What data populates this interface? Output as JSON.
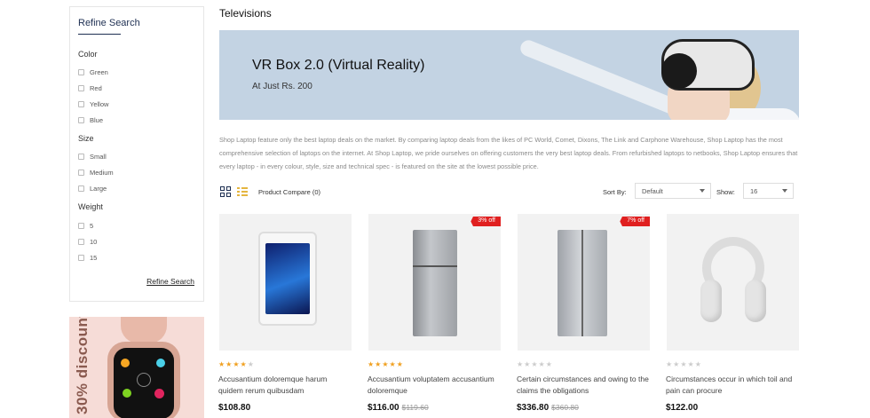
{
  "sidebar": {
    "title": "Refine Search",
    "groups": [
      {
        "title": "Color",
        "options": [
          "Green",
          "Red",
          "Yellow",
          "Blue"
        ]
      },
      {
        "title": "Size",
        "options": [
          "Small",
          "Medium",
          "Large"
        ]
      },
      {
        "title": "Weight",
        "options": [
          "5",
          "10",
          "15"
        ]
      }
    ],
    "refine_link": "Refine Search",
    "promo_text": "30% discount"
  },
  "page_title": "Televisions",
  "banner": {
    "heading": "VR Box 2.0 (Virtual Reality)",
    "subheading": "At Just Rs. 200"
  },
  "description": "Shop Laptop feature only the best laptop deals on the market. By comparing laptop deals from the likes of PC World, Comet, Dixons, The Link and Carphone Warehouse, Shop Laptop has the most comprehensive selection of laptops on the internet. At Shop Laptop, we pride ourselves on offering customers the very best laptop deals. From refurbished laptops to netbooks, Shop Laptop ensures that every laptop - in every colour, style, size and technical spec - is featured on the site at the lowest possible price.",
  "toolbar": {
    "compare": "Product Compare (0)",
    "sort_label": "Sort By:",
    "sort_value": "Default",
    "show_label": "Show:",
    "show_value": "16"
  },
  "colors": {
    "accent": "#1e2f52",
    "star_on": "#f0a020",
    "star_off": "#cccccc",
    "badge": "#e02020"
  },
  "products": [
    {
      "title": "Accusantium doloremque harum quidem rerum quibusdam",
      "price": "$108.80",
      "old_price": "",
      "badge": "",
      "rating": 4,
      "image": "tablet-image"
    },
    {
      "title": "Accusantium voluptatem accusantium doloremque",
      "price": "$116.00",
      "old_price": "$119.60",
      "badge": "3% off",
      "rating": 5,
      "image": "refrigerator-image"
    },
    {
      "title": "Certain circumstances and owing to the claims the obligations",
      "price": "$336.80",
      "old_price": "$360.80",
      "badge": "7% off",
      "rating": 0,
      "image": "side-by-side-fridge-image"
    },
    {
      "title": "Circumstances occur in which toil and pain can procure",
      "price": "$122.00",
      "old_price": "",
      "badge": "",
      "rating": 0,
      "image": "headphones-image"
    }
  ]
}
